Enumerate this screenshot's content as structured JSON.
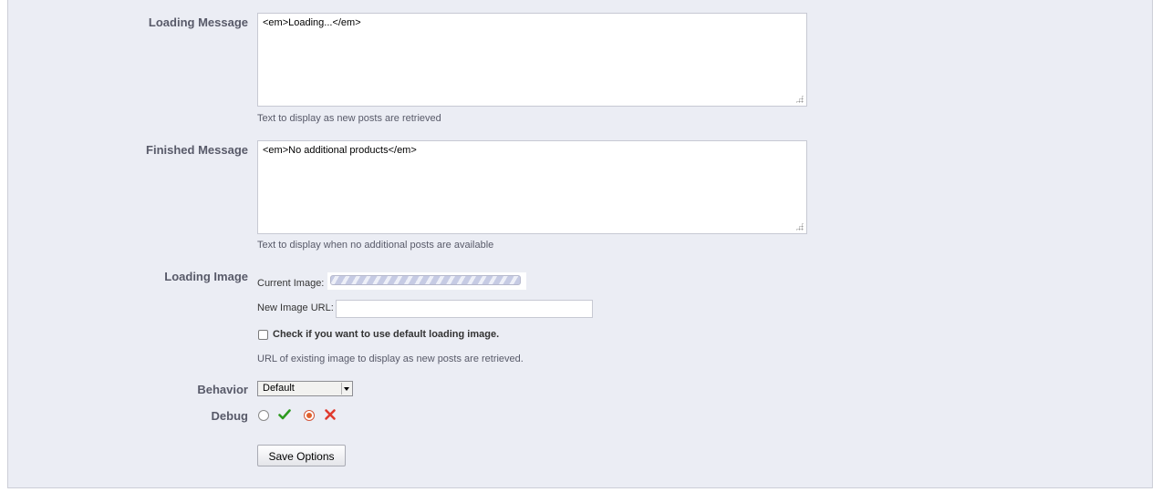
{
  "form": {
    "loading_message": {
      "label": "Loading Message",
      "value": "<em>Loading...</em>",
      "help": "Text to display as new posts are retrieved"
    },
    "finished_message": {
      "label": "Finished Message",
      "value": "<em>No additional products</em>",
      "help": "Text to display when no additional posts are available"
    },
    "loading_image": {
      "label": "Loading Image",
      "current_label": "Current Image:",
      "new_url_label": "New Image URL:",
      "new_url_value": "",
      "default_checkbox_label": "Check if you want to use default loading image.",
      "default_checked": false,
      "help": "URL of existing image to display as new posts are retrieved."
    },
    "behavior": {
      "label": "Behavior",
      "selected": "Default"
    },
    "debug": {
      "label": "Debug",
      "yes_selected": false,
      "no_selected": true,
      "yes_icon": "green-check-icon",
      "no_icon": "red-x-icon"
    },
    "save_button": "Save Options"
  },
  "colors": {
    "panel_bg": "#ebedf4",
    "label": "#585a69",
    "yes": "#2d9a1f",
    "no": "#e03a2e",
    "radio_on": "#e0612e"
  }
}
